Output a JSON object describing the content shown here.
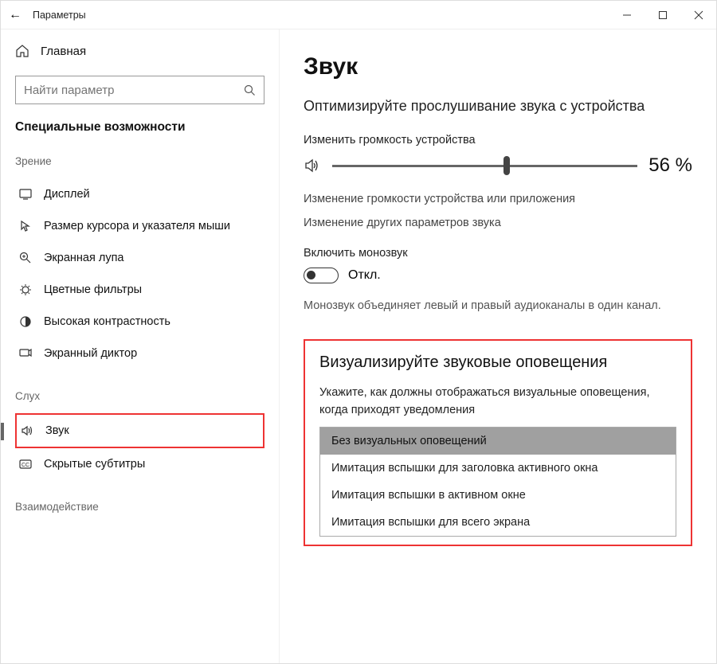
{
  "window": {
    "title": "Параметры"
  },
  "sidebar": {
    "home": "Главная",
    "search_placeholder": "Найти параметр",
    "section": "Специальные возможности",
    "groups": [
      {
        "head": "Зрение",
        "items": [
          {
            "icon": "display-icon",
            "label": "Дисплей"
          },
          {
            "icon": "cursor-icon",
            "label": "Размер курсора и указателя мыши"
          },
          {
            "icon": "magnifier-icon",
            "label": "Экранная лупа"
          },
          {
            "icon": "color-filter-icon",
            "label": "Цветные фильтры"
          },
          {
            "icon": "contrast-icon",
            "label": "Высокая контрастность"
          },
          {
            "icon": "narrator-icon",
            "label": "Экранный диктор"
          }
        ]
      },
      {
        "head": "Слух",
        "items": [
          {
            "icon": "sound-icon",
            "label": "Звук",
            "highlight": true,
            "accent": true
          },
          {
            "icon": "cc-icon",
            "label": "Скрытые субтитры"
          }
        ]
      },
      {
        "head": "Взаимодействие",
        "items": []
      }
    ]
  },
  "main": {
    "title": "Звук",
    "subtitle": "Оптимизируйте прослушивание звука с устройства",
    "volume_label": "Изменить громкость устройства",
    "volume_pct": 56,
    "volume_display": "56 %",
    "link1": "Изменение громкости устройства или приложения",
    "link2": "Изменение других параметров звука",
    "mono_label": "Включить монозвук",
    "mono_state": "Откл.",
    "mono_desc": "Монозвук объединяет левый и правый аудиоканалы в один канал.",
    "visual": {
      "title": "Визуализируйте звуковые оповещения",
      "desc": "Укажите, как должны отображаться визуальные оповещения, когда приходят уведомления",
      "options": [
        "Без визуальных оповещений",
        "Имитация вспышки для заголовка активного окна",
        "Имитация вспышки в активном окне",
        "Имитация вспышки для всего экрана"
      ]
    }
  }
}
